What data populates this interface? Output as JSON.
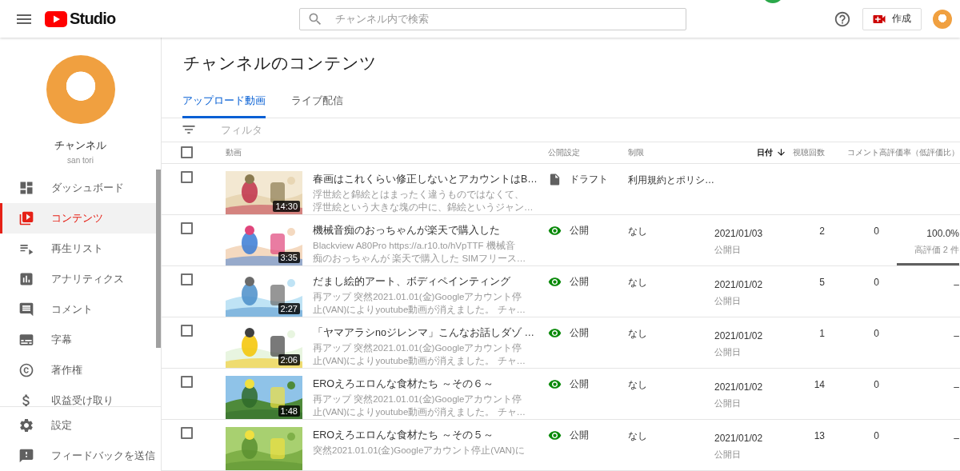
{
  "header": {
    "logo_text": "Studio",
    "search": {
      "placeholder": "チャンネル内で検索"
    },
    "create_button": "作成"
  },
  "sidebar": {
    "channel_name": "チャンネル",
    "channel_handle": "san tori",
    "items": [
      {
        "label": "ダッシュボード",
        "selected": false
      },
      {
        "label": "コンテンツ",
        "selected": true
      },
      {
        "label": "再生リスト",
        "selected": false
      },
      {
        "label": "アナリティクス",
        "selected": false
      },
      {
        "label": "コメント",
        "selected": false
      },
      {
        "label": "字幕",
        "selected": false
      },
      {
        "label": "著作権",
        "selected": false
      },
      {
        "label": "収益受け取り",
        "selected": false
      }
    ],
    "footer_items": [
      {
        "label": "設定",
        "selected": false
      },
      {
        "label": "フィードバックを送信",
        "selected": false
      }
    ]
  },
  "page_title": "チャンネルのコンテンツ",
  "tabs": [
    {
      "label": "アップロード動画",
      "selected": true
    },
    {
      "label": "ライブ配信",
      "selected": false
    }
  ],
  "filter": {
    "placeholder": "フィルタ"
  },
  "table": {
    "select_all_checked": false,
    "columns": [
      {
        "label": "動画",
        "sorted": false
      },
      {
        "label": "公開設定",
        "sorted": false
      },
      {
        "label": "制限",
        "sorted": false
      },
      {
        "label": "日付",
        "sorted": true
      },
      {
        "label": "視聴回数",
        "sorted": false
      },
      {
        "label": "コメント",
        "sorted": false
      },
      {
        "label": "高評価率（低評価比）",
        "sorted": false
      }
    ],
    "rows": [
      {
        "checked": false,
        "duration": "14:30",
        "title": "春画はこれくらい修正しないとアカウントはB…",
        "description": [
          "浮世絵と錦絵とはまったく違うものではなくて、",
          "浮世絵という大きな塊の中に、錦絵というジャン…"
        ],
        "visibility": {
          "kind": "draft",
          "label": "ドラフト"
        },
        "restriction": "利用規約とポリシ…"
      },
      {
        "checked": false,
        "duration": "3:35",
        "title": "機械音痴のおっちゃんが楽天で購入した",
        "description": [
          "Blackview A80Pro https://a.r10.to/hVpTTF 機械音",
          "痴のおっちゃんが 楽天で購入した SIMフリース…"
        ],
        "visibility": {
          "kind": "public",
          "label": "公開"
        },
        "restriction": "なし",
        "date": "2021/01/03",
        "date_label": "公開日",
        "views": "2",
        "comments": "0",
        "rating": "100.0%",
        "rating_detail": "高評価 2 件",
        "level": 1
      },
      {
        "checked": false,
        "duration": "2:27",
        "title": "だまし絵的アート、ボディペインティング",
        "description": [
          "再アップ 突然2021.01.01(金)Googleアカウント停",
          "止(VAN)によりyoutube動画が消えました。 チャ…"
        ],
        "visibility": {
          "kind": "public",
          "label": "公開"
        },
        "restriction": "なし",
        "date": "2021/01/02",
        "date_label": "公開日",
        "views": "5",
        "comments": "0",
        "rating": "–"
      },
      {
        "checked": false,
        "duration": "2:06",
        "title": "「ヤマアラシnoジレンマ」こんなお話しダゾ …",
        "description": [
          "再アップ 突然2021.01.01(金)Googleアカウント停",
          "止(VAN)によりyoutube動画が消えました。 チャ…"
        ],
        "visibility": {
          "kind": "public",
          "label": "公開"
        },
        "restriction": "なし",
        "date": "2021/01/02",
        "date_label": "公開日",
        "views": "1",
        "comments": "0",
        "rating": "–"
      },
      {
        "checked": false,
        "duration": "1:48",
        "title": "EROえろエロんな食材たち ～その６～",
        "description": [
          "再アップ 突然2021.01.01(金)Googleアカウント停",
          "止(VAN)によりyoutube動画が消えました。 チャ…"
        ],
        "visibility": {
          "kind": "public",
          "label": "公開"
        },
        "restriction": "なし",
        "date": "2021/01/02",
        "date_label": "公開日",
        "views": "14",
        "comments": "0",
        "rating": "–"
      },
      {
        "checked": false,
        "title": "EROえろエロんな食材たち ～その５～",
        "description": [
          "突然2021.01.01(金)Googleアカウント停止(VAN)に"
        ],
        "visibility": {
          "kind": "public",
          "label": "公開"
        },
        "restriction": "なし",
        "date": "2021/01/02",
        "date_label": "公開日",
        "views": "13",
        "comments": "0",
        "rating": "–"
      }
    ]
  }
}
